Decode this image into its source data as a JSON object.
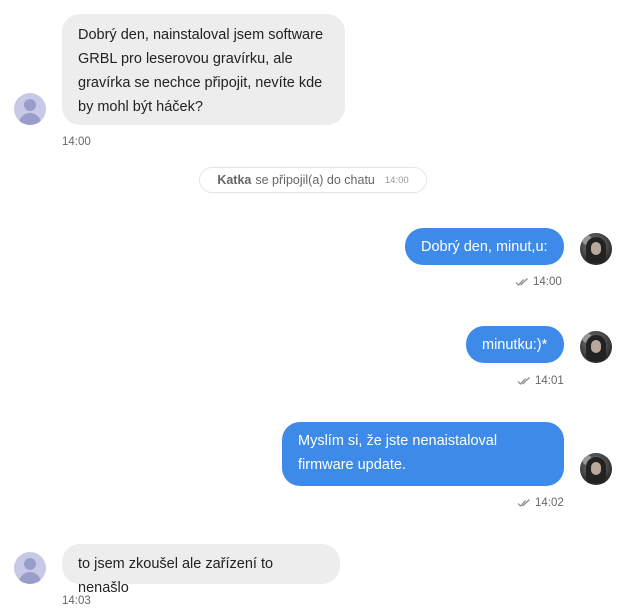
{
  "messages": [
    {
      "text_lines": [
        "Dobrý den, nainstaloval jsem software",
        "GRBL pro leserovou gravírku, ale",
        "gravírka se nechce připojit, nevíte kde",
        "by mohl být háček?"
      ],
      "time": "14:00"
    },
    {
      "text": "Dobrý den, minut,u:",
      "time": "14:00"
    },
    {
      "text": "minutku:)*",
      "time": "14:01"
    },
    {
      "text_lines": [
        "Myslím si, že jste nenaistaloval",
        "firmware update."
      ],
      "time": "14:02"
    },
    {
      "text": "to jsem zkoušel ale zařízení to nenašlo",
      "time": "14:03"
    }
  ],
  "system": {
    "name": "Katka",
    "text": "se připojil(a) do chatu",
    "time": "14:00"
  },
  "icons": {
    "read": "double-check-icon",
    "user_avatar": "user-avatar-icon",
    "agent_avatar": "agent-photo-avatar"
  },
  "colors": {
    "outgoing": "#3d8ae8",
    "incoming": "#ededed"
  }
}
